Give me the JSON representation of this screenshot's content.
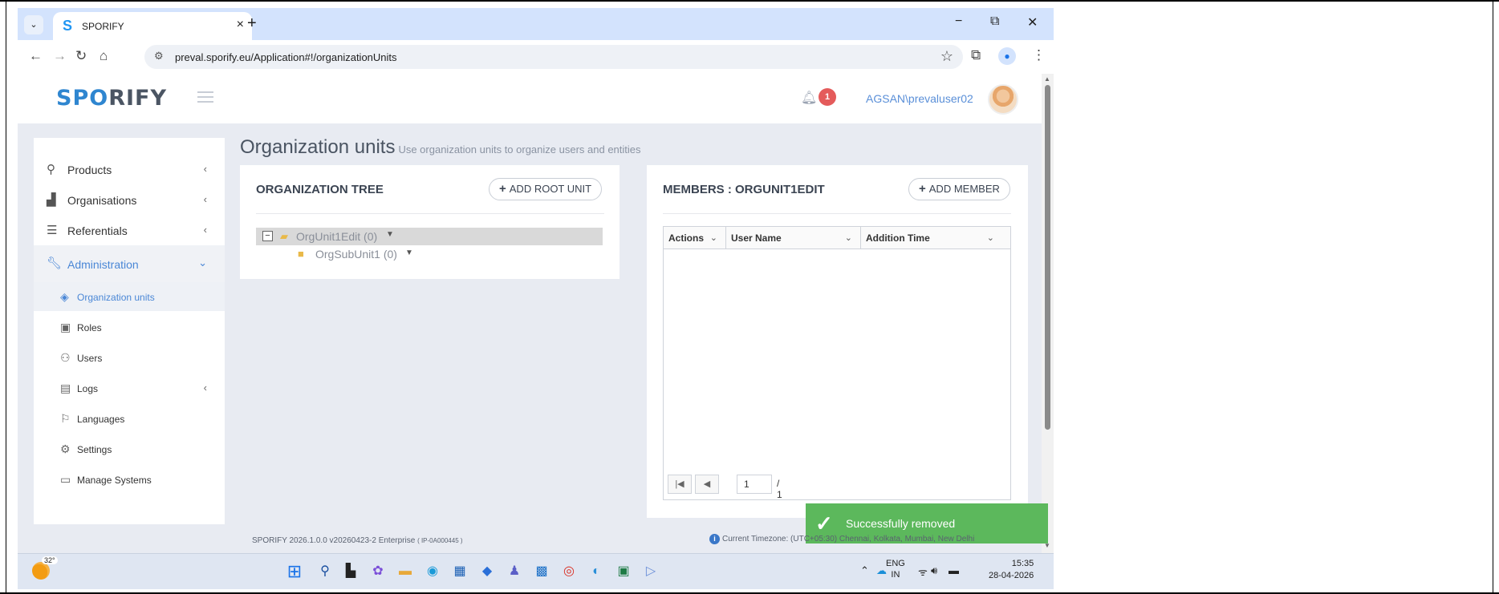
{
  "browser": {
    "tab_title": "SPORIFY",
    "tab_close": "×",
    "new_tab": "+",
    "url": "preval.sporify.eu/Application#!/organizationUnits",
    "window_controls": [
      "−",
      "⧉",
      "✕"
    ]
  },
  "app": {
    "logo_prefix": "SP",
    "logo_mid": "O",
    "logo_suffix": "RIFY",
    "notification_count": "1",
    "user": "AGSAN\\prevaluser02"
  },
  "sidebar": {
    "items": [
      {
        "label": "Products",
        "icon": "products-icon"
      },
      {
        "label": "Organisations",
        "icon": "factory-icon"
      },
      {
        "label": "Referentials",
        "icon": "list-icon"
      },
      {
        "label": "Administration",
        "icon": "wrench-icon"
      }
    ],
    "sub_items": [
      {
        "label": "Organization units",
        "icon": "layers-icon"
      },
      {
        "label": "Roles",
        "icon": "roles-icon"
      },
      {
        "label": "Users",
        "icon": "users-icon"
      },
      {
        "label": "Logs",
        "icon": "book-icon"
      },
      {
        "label": "Languages",
        "icon": "flag-icon"
      },
      {
        "label": "Settings",
        "icon": "gear-icon"
      },
      {
        "label": "Manage Systems",
        "icon": "laptop-icon"
      }
    ]
  },
  "page": {
    "title": "Organization units",
    "subtitle": "Use organization units to organize users and entities"
  },
  "tree": {
    "title": "ORGANIZATION TREE",
    "add_root_label": "ADD ROOT UNIT",
    "nodes": [
      {
        "label": "OrgUnit1Edit (0)"
      },
      {
        "label": "OrgSubUnit1 (0)"
      }
    ]
  },
  "members": {
    "title": "MEMBERS : ORGUNIT1EDIT",
    "add_member_label": "ADD MEMBER",
    "columns": [
      "Actions",
      "User Name",
      "Addition Time"
    ],
    "page_number": "1",
    "page_total": "/ 1"
  },
  "toast": {
    "message": "Successfully removed",
    "color": "#5cb85c"
  },
  "footer": {
    "version": "SPORIFY 2026.1.0.0 v20260423-2 Enterprise",
    "build": "( IP-0A000445 )",
    "timezone": "Current Timezone: (UTC+05:30) Chennai, Kolkata, Mumbai, New Delhi"
  },
  "taskbar": {
    "temperature": "32°",
    "lang_top": "ENG",
    "lang_bottom": "IN",
    "time": "15:35",
    "date": "28-04-2026"
  }
}
